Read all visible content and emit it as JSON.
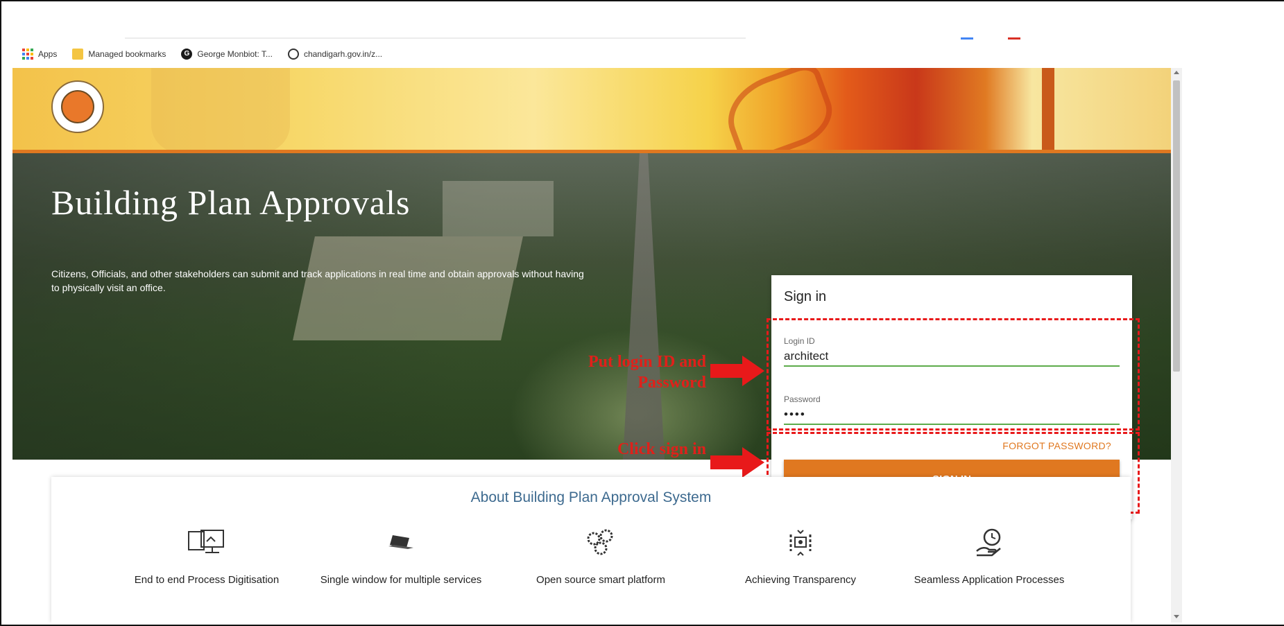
{
  "bookmarks_bar": {
    "items": [
      {
        "label": "Apps",
        "icon": "apps-grid-icon"
      },
      {
        "label": "Managed bookmarks",
        "icon": "folder-icon"
      },
      {
        "label": "George Monbiot: T...",
        "icon": "site-favicon-icon"
      },
      {
        "label": "chandigarh.gov.in/z...",
        "icon": "globe-icon"
      }
    ]
  },
  "hero": {
    "title": "Building Plan Approvals",
    "description": "Citizens, Officials, and other stakeholders can submit and track applications in real time and obtain approvals without having to physically visit an office."
  },
  "annotations": {
    "put_login": "Put login ID and Password",
    "click_signin": "Click sign in"
  },
  "signin": {
    "title": "Sign in",
    "login_label": "Login ID",
    "login_value": "architect",
    "password_label": "Password",
    "password_value": "••••",
    "forgot": "FORGOT PASSWORD?",
    "button": "SIGN IN"
  },
  "about": {
    "title": "About Building Plan Approval System",
    "features": [
      {
        "label": "End to end Process Digitisation",
        "icon": "computer-monitor-icon"
      },
      {
        "label": "Single window for multiple services",
        "icon": "laptop-icon"
      },
      {
        "label": "Open source smart platform",
        "icon": "gears-icon"
      },
      {
        "label": "Achieving Transparency",
        "icon": "transparency-cycle-icon"
      },
      {
        "label": "Seamless Application Processes",
        "icon": "hand-clock-icon"
      }
    ]
  },
  "colors": {
    "accent": "#e07820",
    "annotation": "#e8191a",
    "input_underline": "#5cab4a",
    "about_title": "#3d6a8f"
  }
}
